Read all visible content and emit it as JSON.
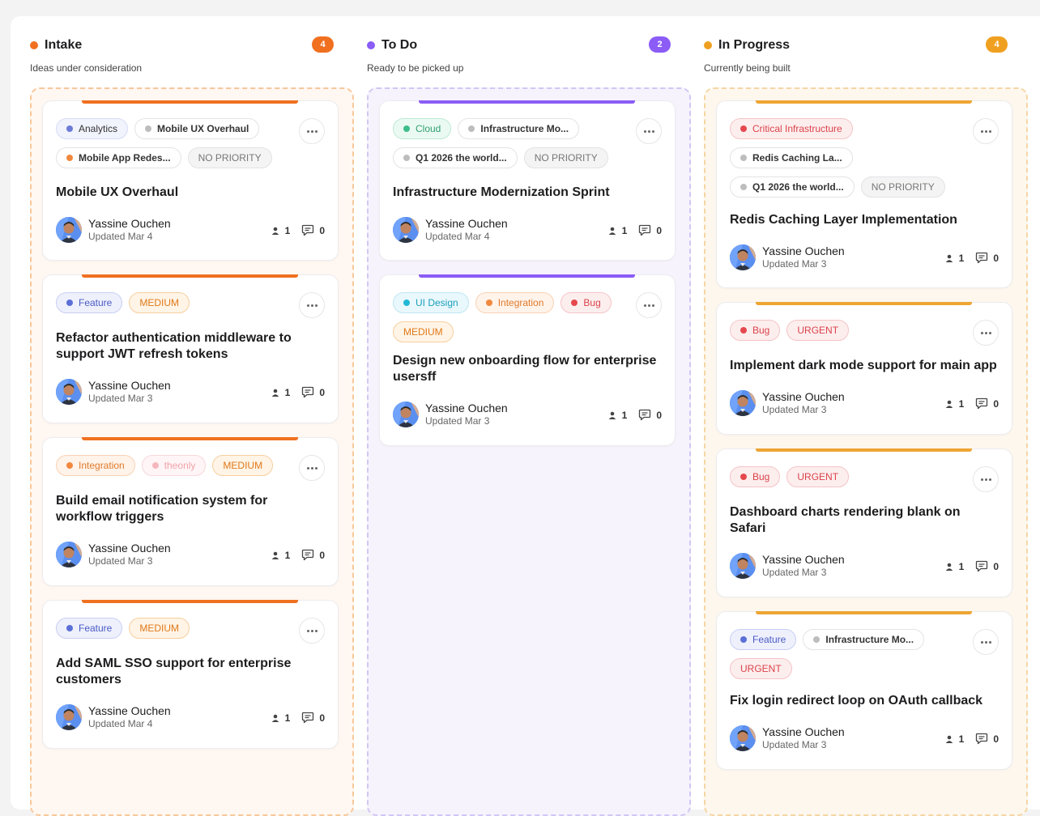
{
  "columns": [
    {
      "title": "Intake",
      "subtitle": "Ideas under consideration",
      "count": "4",
      "dot_color": "#f07020",
      "count_bg": "#f07020",
      "lane_border": "#f7c89a",
      "lane_bg": "#fff7f1",
      "bar_color": "#f07020",
      "cards": [
        {
          "tags": [
            {
              "label": "Analytics",
              "style": "type",
              "dot": "#6b7bd6",
              "fg": "#333",
              "bg": "#f1f3fd",
              "border": "#d7dcf5"
            },
            {
              "label": "Mobile UX Overhaul",
              "style": "project",
              "dot": "#bdbdbd"
            },
            {
              "label": "Mobile App Redes...",
              "style": "project",
              "dot": "#f0883e"
            },
            {
              "label": "NO PRIORITY",
              "style": "priority",
              "fg": "#777",
              "bg": "#f4f4f5",
              "border": "#e3e3e6"
            }
          ],
          "title": "Mobile UX Overhaul",
          "author": "Yassine Ouchen",
          "updated": "Updated Mar 4",
          "assignees": "1",
          "comments": "0"
        },
        {
          "tags": [
            {
              "label": "Feature",
              "style": "type",
              "dot": "#5b6fd6",
              "fg": "#4a5bc4",
              "bg": "#eef0fc",
              "border": "#c9cff3"
            },
            {
              "label": "MEDIUM",
              "style": "priority",
              "fg": "#e0791a",
              "bg": "#fff4e6",
              "border": "#f7cf9f"
            }
          ],
          "title": "Refactor authentication middleware to support JWT refresh tokens",
          "author": "Yassine Ouchen",
          "updated": "Updated Mar 3",
          "assignees": "1",
          "comments": "0"
        },
        {
          "tags": [
            {
              "label": "Integration",
              "style": "type",
              "dot": "#f0883e",
              "fg": "#e07a2a",
              "bg": "#fff3ea",
              "border": "#f8d2b4"
            },
            {
              "label": "theonly",
              "style": "type",
              "dot": "#f5b7bd",
              "fg": "#f0a3aa",
              "bg": "#fff5f6",
              "border": "#f8d7da"
            },
            {
              "label": "MEDIUM",
              "style": "priority",
              "fg": "#e0791a",
              "bg": "#fff4e6",
              "border": "#f7cf9f"
            }
          ],
          "title": "Build email notification system for workflow triggers",
          "author": "Yassine Ouchen",
          "updated": "Updated Mar 3",
          "assignees": "1",
          "comments": "0"
        },
        {
          "tags": [
            {
              "label": "Feature",
              "style": "type",
              "dot": "#5b6fd6",
              "fg": "#4a5bc4",
              "bg": "#eef0fc",
              "border": "#c9cff3"
            },
            {
              "label": "MEDIUM",
              "style": "priority",
              "fg": "#e0791a",
              "bg": "#fff4e6",
              "border": "#f7cf9f"
            }
          ],
          "title": "Add SAML SSO support for enterprise customers",
          "author": "Yassine Ouchen",
          "updated": "Updated Mar 4",
          "assignees": "1",
          "comments": "0"
        }
      ]
    },
    {
      "title": "To Do",
      "subtitle": "Ready to be picked up",
      "count": "2",
      "dot_color": "#8b5cf6",
      "count_bg": "#8b5cf6",
      "lane_border": "#d3c6f4",
      "lane_bg": "#f6f3fd",
      "bar_color": "#8b5cf6",
      "cards": [
        {
          "tags": [
            {
              "label": "Cloud",
              "style": "type",
              "dot": "#3dbd8a",
              "fg": "#2f9f72",
              "bg": "#eafaf2",
              "border": "#bfead4"
            },
            {
              "label": "Infrastructure Mo...",
              "style": "project",
              "dot": "#bdbdbd"
            },
            {
              "label": "Q1 2026 the world...",
              "style": "project",
              "dot": "#bdbdbd"
            },
            {
              "label": "NO PRIORITY",
              "style": "priority",
              "fg": "#777",
              "bg": "#f4f4f5",
              "border": "#e3e3e6"
            }
          ],
          "title": "Infrastructure Modernization Sprint",
          "author": "Yassine Ouchen",
          "updated": "Updated Mar 4",
          "assignees": "1",
          "comments": "0"
        },
        {
          "tags": [
            {
              "label": "UI Design",
              "style": "type",
              "dot": "#22b8d8",
              "fg": "#1c9fbd",
              "bg": "#e9f8fc",
              "border": "#bfe7f2"
            },
            {
              "label": "Integration",
              "style": "type",
              "dot": "#f0883e",
              "fg": "#e07a2a",
              "bg": "#fff3ea",
              "border": "#f8d2b4"
            },
            {
              "label": "Bug",
              "style": "type",
              "dot": "#e5484d",
              "fg": "#d9434a",
              "bg": "#fdeeee",
              "border": "#f5c4c6"
            },
            {
              "label": "MEDIUM",
              "style": "priority",
              "fg": "#e0791a",
              "bg": "#fff4e6",
              "border": "#f7cf9f"
            }
          ],
          "title": "Design new onboarding flow for enterprise usersff",
          "author": "Yassine Ouchen",
          "updated": "Updated Mar 3",
          "assignees": "1",
          "comments": "0"
        }
      ]
    },
    {
      "title": "In Progress",
      "subtitle": "Currently being built",
      "count": "4",
      "dot_color": "#f0a020",
      "count_bg": "#f0a020",
      "lane_border": "#f5d6a3",
      "lane_bg": "#fdf7ee",
      "bar_color": "#eea533",
      "cards": [
        {
          "tags": [
            {
              "label": "Critical Infrastructure",
              "style": "type",
              "dot": "#e5484d",
              "fg": "#d9434a",
              "bg": "#fdeeee",
              "border": "#f5c4c6"
            },
            {
              "label": "Redis Caching La...",
              "style": "project",
              "dot": "#bdbdbd"
            },
            {
              "label": "Q1 2026 the world...",
              "style": "project",
              "dot": "#bdbdbd"
            },
            {
              "label": "NO PRIORITY",
              "style": "priority",
              "fg": "#777",
              "bg": "#f4f4f5",
              "border": "#e3e3e6"
            }
          ],
          "title": "Redis Caching Layer Implementation",
          "author": "Yassine Ouchen",
          "updated": "Updated Mar 3",
          "assignees": "1",
          "comments": "0"
        },
        {
          "tags": [
            {
              "label": "Bug",
              "style": "type",
              "dot": "#e5484d",
              "fg": "#d9434a",
              "bg": "#fdeeee",
              "border": "#f5c4c6"
            },
            {
              "label": "URGENT",
              "style": "priority",
              "fg": "#d9434a",
              "bg": "#fdeeee",
              "border": "#f5c4c6"
            }
          ],
          "title": "Implement dark mode support for main app",
          "author": "Yassine Ouchen",
          "updated": "Updated Mar 3",
          "assignees": "1",
          "comments": "0"
        },
        {
          "tags": [
            {
              "label": "Bug",
              "style": "type",
              "dot": "#e5484d",
              "fg": "#d9434a",
              "bg": "#fdeeee",
              "border": "#f5c4c6"
            },
            {
              "label": "URGENT",
              "style": "priority",
              "fg": "#d9434a",
              "bg": "#fdeeee",
              "border": "#f5c4c6"
            }
          ],
          "title": "Dashboard charts rendering blank on Safari",
          "author": "Yassine Ouchen",
          "updated": "Updated Mar 3",
          "assignees": "1",
          "comments": "0"
        },
        {
          "tags": [
            {
              "label": "Feature",
              "style": "type",
              "dot": "#5b6fd6",
              "fg": "#4a5bc4",
              "bg": "#eef0fc",
              "border": "#c9cff3"
            },
            {
              "label": "Infrastructure Mo...",
              "style": "project",
              "dot": "#bdbdbd"
            },
            {
              "label": "URGENT",
              "style": "priority",
              "fg": "#d9434a",
              "bg": "#fdeeee",
              "border": "#f5c4c6"
            }
          ],
          "title": "Fix login redirect loop on OAuth callback",
          "author": "Yassine Ouchen",
          "updated": "Updated Mar 3",
          "assignees": "1",
          "comments": "0"
        }
      ]
    }
  ]
}
